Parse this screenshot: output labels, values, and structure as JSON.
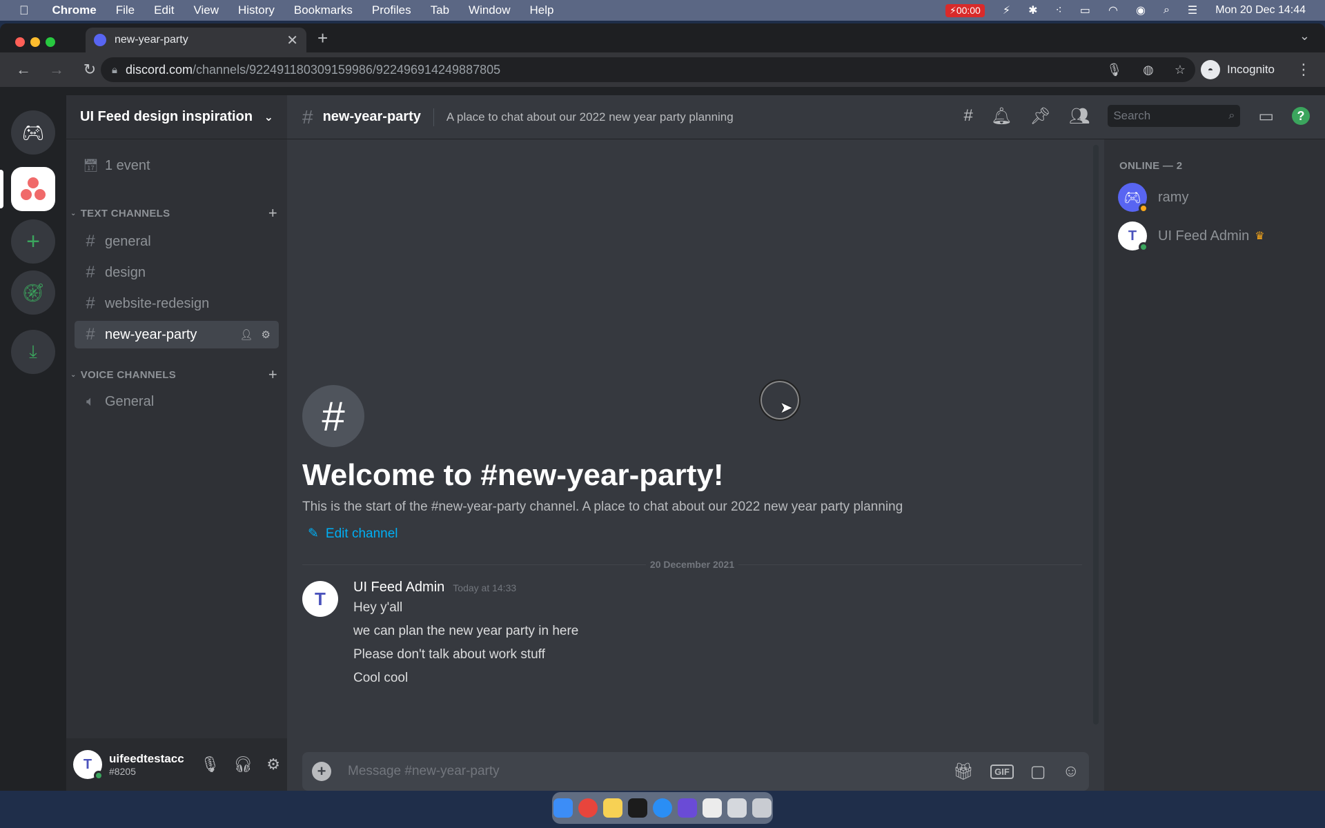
{
  "menubar": {
    "apple": "",
    "app": "Chrome",
    "items": [
      "File",
      "Edit",
      "View",
      "History",
      "Bookmarks",
      "Profiles",
      "Tab",
      "Window",
      "Help"
    ],
    "recording": "00:00",
    "datetime": "Mon 20 Dec 14:44"
  },
  "browser": {
    "tab_title": "new-year-party",
    "tab_close": "✕",
    "new_tab": "+",
    "url_domain": "discord.com",
    "url_path": "/channels/922491180309159986/922496914249887805",
    "profile": "Incognito"
  },
  "server": {
    "name": "UI Feed design inspiration",
    "events": "1 event",
    "text_category": "TEXT CHANNELS",
    "text_channels": [
      "general",
      "design",
      "website-redesign",
      "new-year-party"
    ],
    "voice_category": "VOICE CHANNELS",
    "voice_channels": [
      "General"
    ]
  },
  "user": {
    "name": "uifeedtestacc",
    "discriminator": "#8205"
  },
  "channel": {
    "name": "new-year-party",
    "topic": "A place to chat about our 2022 new year party planning",
    "search_placeholder": "Search"
  },
  "welcome": {
    "title": "Welcome to #new-year-party!",
    "subtitle": "This is the start of the #new-year-party channel. A place to chat about our 2022 new year party planning",
    "edit_label": "Edit channel"
  },
  "messages": {
    "date": "20 December 2021",
    "author": "UI Feed Admin",
    "time": "Today at 14:33",
    "lines": [
      "Hey y'all",
      "we can plan the new year party in here",
      "Please don't talk about work stuff",
      "Cool cool"
    ]
  },
  "composer": {
    "placeholder": "Message #new-year-party",
    "gif": "GIF"
  },
  "members": {
    "header": "ONLINE — 2",
    "list": [
      "ramy",
      "UI Feed Admin"
    ]
  },
  "colors": {
    "blurple": "#5865f2",
    "online": "#3ba55d",
    "idle": "#faa81a",
    "link": "#00aff4"
  }
}
